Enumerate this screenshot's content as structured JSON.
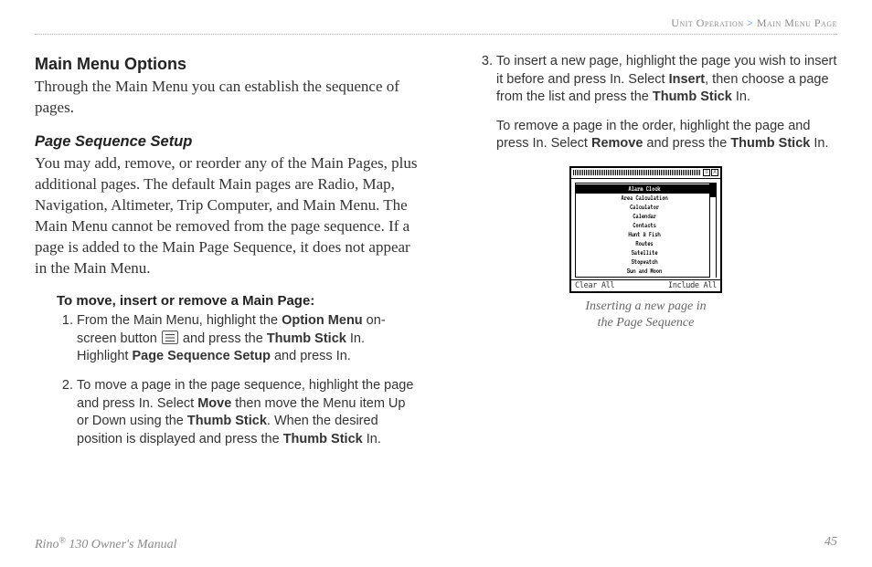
{
  "header": {
    "section": "Unit Operation",
    "separator": " > ",
    "subsection": "Main Menu Page"
  },
  "heading_main": "Main Menu Options",
  "intro": "Through the Main Menu you can establish the sequence of pages.",
  "heading_sub": "Page Sequence Setup",
  "sub_para": "You may add, remove, or reorder any of the Main Pages, plus additional pages. The default Main pages are Radio, Map, Navigation, Altimeter, Trip Computer, and Main Menu. The Main Menu cannot be removed from the page sequence. If a page is added to the Main Page Sequence, it does not appear in the Main Menu.",
  "task_heading": "To move, insert or remove a Main Page:",
  "step1": {
    "t1": "From the Main Menu, highlight the ",
    "b1": "Option Menu",
    "t2": " on-screen button ",
    "t3": " and press the ",
    "b2": "Thumb Stick",
    "t4": " In. Highlight ",
    "b3": "Page Sequence Setup",
    "t5": " and press In."
  },
  "step2": {
    "t1": "To move a page in the page sequence, highlight the page and press In. Select ",
    "b1": "Move",
    "t2": " then move the Menu item Up or Down using the ",
    "b2": "Thumb Stick",
    "t3": ". When the desired position is displayed and press the ",
    "b3": "Thumb Stick",
    "t4": " In."
  },
  "step3": {
    "t1": "To insert a new page, highlight the page you wish to insert it before and press In. Select ",
    "b1": "Insert",
    "t2": ", then choose a page from the list and press the ",
    "b2": "Thumb Stick",
    "t3": " In."
  },
  "follow": {
    "t1": "To remove a page in the order, highlight the page and press In. Select ",
    "b1": "Remove",
    "t2": " and press the ",
    "b2": "Thumb Stick",
    "t3": " In."
  },
  "figure": {
    "list_items": [
      "Alarm Clock",
      "Area Calculation",
      "Calculator",
      "Calendar",
      "Contacts",
      "Hunt & Fish",
      "Routes",
      "Satellite",
      "Stopwatch",
      "Sun and Moon"
    ],
    "footer_left": "Clear All",
    "footer_right": "Include All",
    "title_menu": "≡",
    "title_close": "X",
    "caption_l1": "Inserting a new page in",
    "caption_l2": "the Page Sequence"
  },
  "footer": {
    "product_prefix": "Rino",
    "reg": "®",
    "product_suffix": " 130 Owner's Manual",
    "page_number": "45"
  }
}
